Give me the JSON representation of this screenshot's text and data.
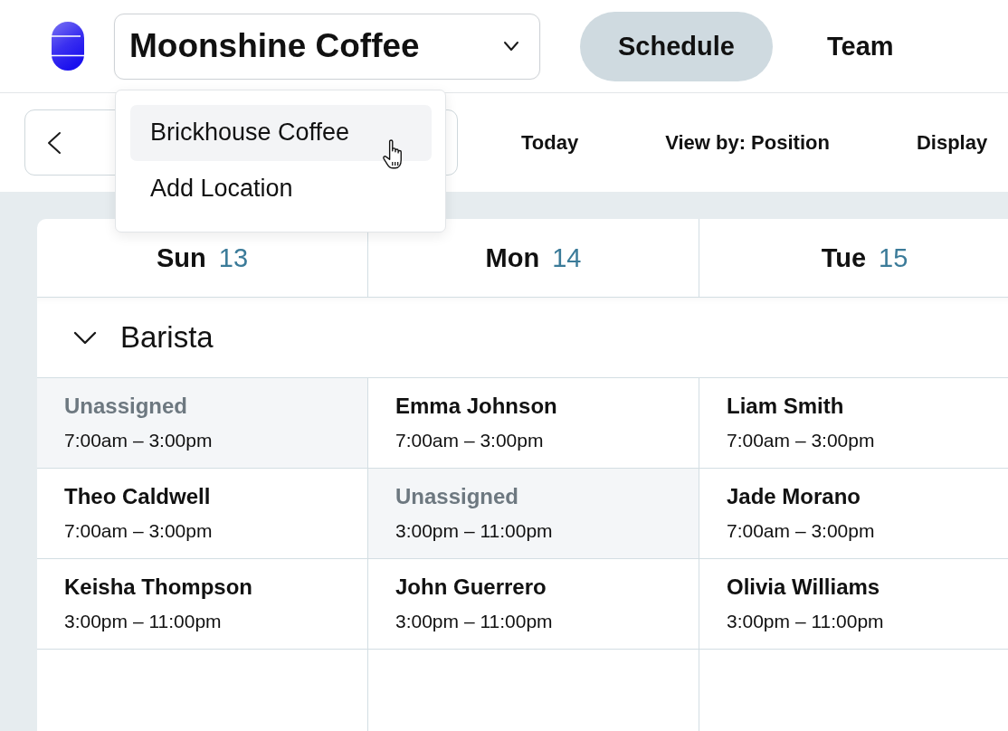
{
  "header": {
    "location_select": {
      "value": "Moonshine Coffee",
      "expanded": true,
      "options": [
        {
          "label": "Brickhouse Coffee",
          "hovered": true
        },
        {
          "label": "Add Location",
          "hovered": false
        }
      ]
    },
    "tabs": [
      {
        "label": "Schedule",
        "selected": true
      },
      {
        "label": "Team",
        "selected": false
      }
    ]
  },
  "toolbar": {
    "buttons": [
      "Today",
      "View by: Position",
      "Display"
    ]
  },
  "schedule": {
    "days": [
      {
        "weekday": "Sun",
        "date": "13"
      },
      {
        "weekday": "Mon",
        "date": "14"
      },
      {
        "weekday": "Tue",
        "date": "15"
      }
    ],
    "groups": [
      {
        "name": "Barista",
        "expanded": true,
        "rows": [
          {
            "cells": [
              {
                "name": "Unassigned",
                "time": "7:00am – 3:00pm",
                "unassigned": true
              },
              {
                "name": "Emma Johnson",
                "time": "7:00am – 3:00pm",
                "unassigned": false
              },
              {
                "name": "Liam Smith",
                "time": "7:00am – 3:00pm",
                "unassigned": false
              }
            ]
          },
          {
            "cells": [
              {
                "name": "Theo Caldwell",
                "time": "7:00am – 3:00pm",
                "unassigned": false
              },
              {
                "name": "Unassigned",
                "time": "3:00pm – 11:00pm",
                "unassigned": true
              },
              {
                "name": "Jade Morano",
                "time": "7:00am – 3:00pm",
                "unassigned": false
              }
            ]
          },
          {
            "cells": [
              {
                "name": "Keisha Thompson",
                "time": "3:00pm – 11:00pm",
                "unassigned": false
              },
              {
                "name": "John Guerrero",
                "time": "3:00pm – 11:00pm",
                "unassigned": false
              },
              {
                "name": "Olivia Williams",
                "time": "3:00pm – 11:00pm",
                "unassigned": false
              }
            ]
          }
        ]
      }
    ]
  }
}
